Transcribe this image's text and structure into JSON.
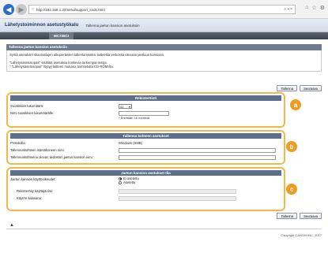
{
  "browser": {
    "url": "http://192.168.1.24/send/support_snds.html",
    "url_actions": "⌕ ▾ ×"
  },
  "header": {
    "app_title": "Lähetystoiminnon asetustyökalu",
    "breadcrumb": "Tallenna jaetun kansion asetuksiin"
  },
  "model": "MC735CI",
  "info_panel": {
    "title": "Tallenna jaetun kansion asetuksiin",
    "line1": "Syötä asetukset skannattujen alkuperäisten tallentamiseksi laitteesta verkossa olevaan jaettuun kansioon.",
    "line2": "\"Lähetysasetusopas\" sisältää asetuksia koskevia tarkempia tietoja.",
    "line3": "* \"Lähetysasetusopas\" löytyy laitteen mukana toimitetulta CD-ROM:ilta."
  },
  "buttons": {
    "save": "Tallenna",
    "next": "Seuraava"
  },
  "register": {
    "title": "Rekisteröinti",
    "favorite_number_label": "Suosikkien lukumäärä:",
    "favorite_number_value": "02",
    "favorite_name_label": "Nimi suosikkien lukumäärälle:",
    "favorite_name_value": "",
    "hint": "* Enintään 16 merkkiä"
  },
  "destination": {
    "title": "Tallenna kohteen asetukset",
    "protocol_label": "Protokolla:",
    "protocol_value": "Windows (SMB)",
    "host_label": "Tallennuskohteen isäntäkoneen nimi:",
    "path_label": "Tallennuskohteena olevan tiedoston jaetun kansion nimi:"
  },
  "share": {
    "title": "Jaetun kansion asetukset tila",
    "user_label": "Jaetun kansion käyttöoikeudet:",
    "option_off": "Ei asetettu",
    "option_on": "Asetettu",
    "username_label": "Rekisteröity käyttäjänimi:",
    "password_label": "Käytön salasana:"
  },
  "callouts": {
    "a": "a",
    "b": "b",
    "c": "c"
  },
  "footer": {
    "up_arrow": "▲",
    "copyright": "Copyright CANON INC. 2017"
  },
  "colors": {
    "callout": "#ee9d24",
    "section_border": "#f2b84b",
    "header_accent": "#1b3c6e"
  }
}
